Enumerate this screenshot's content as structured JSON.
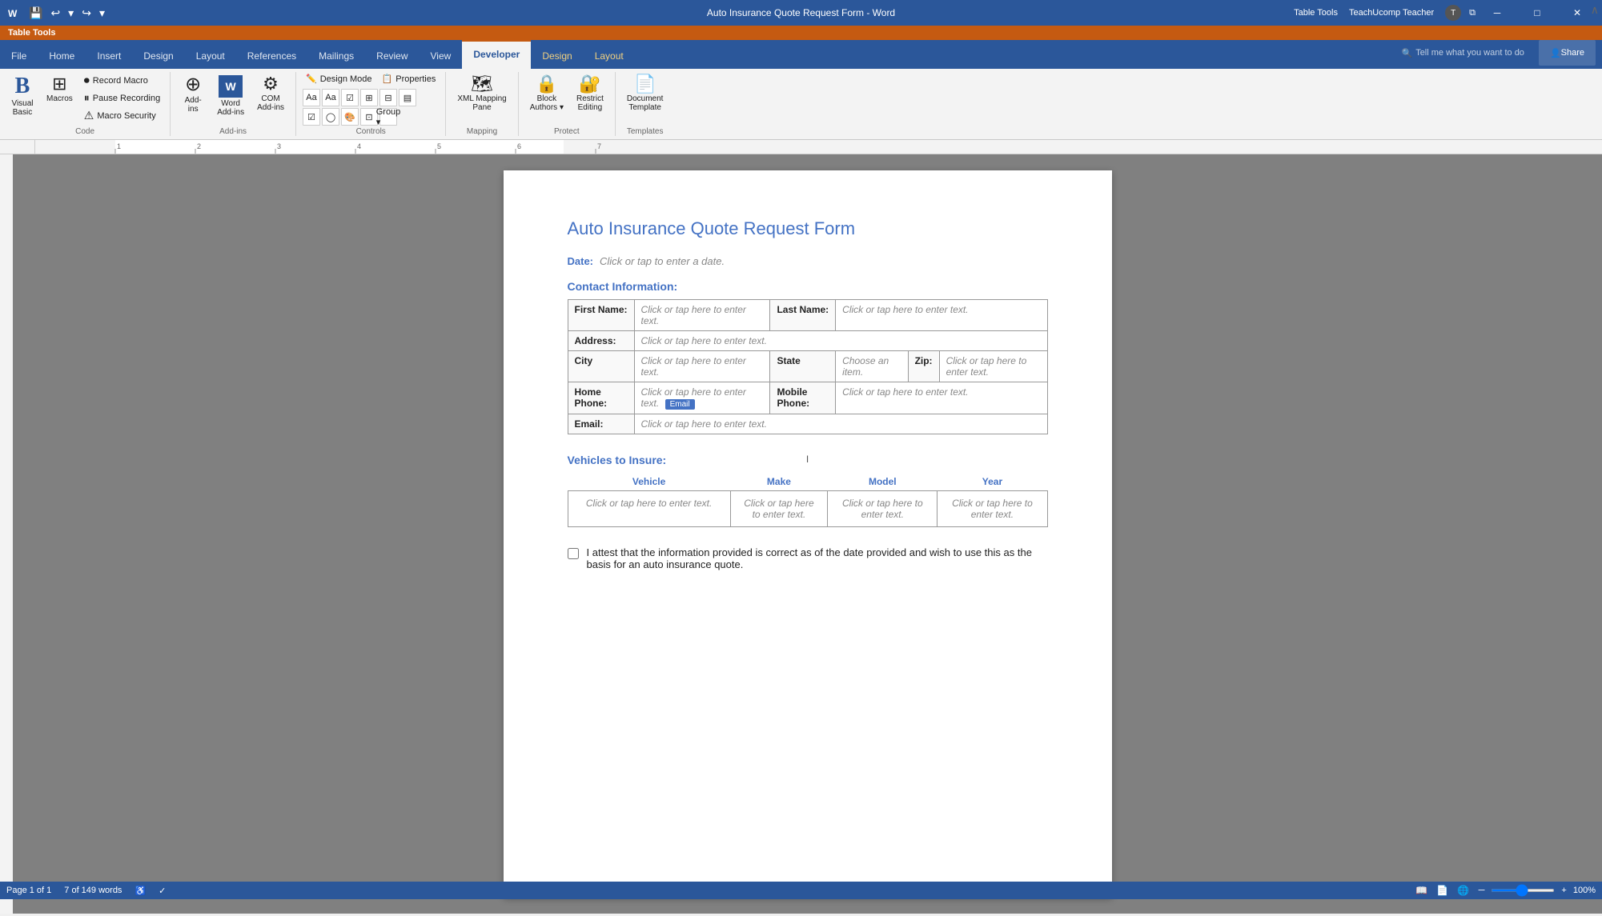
{
  "titleBar": {
    "title": "Auto Insurance Quote Request Form - Word",
    "tableTools": "Table Tools",
    "user": "TeachUcomp Teacher",
    "icons": {
      "save": "💾",
      "undo": "↩",
      "redo": "↪",
      "customize": "▾"
    }
  },
  "ribbon": {
    "tabs": [
      "File",
      "Home",
      "Insert",
      "Design",
      "Layout",
      "References",
      "Mailings",
      "Review",
      "View",
      "Developer",
      "Design",
      "Layout"
    ],
    "activeTab": "Developer",
    "tellMe": "Tell me what you want to do",
    "share": "Share",
    "groups": {
      "code": {
        "label": "Code",
        "buttons": {
          "visualBasic": {
            "label": "Visual\nBasic",
            "icon": "𝓑"
          },
          "macros": {
            "label": "Macros",
            "icon": "⬛"
          },
          "recordMacro": "Record Macro",
          "pauseRecording": "Pause Recording",
          "macroSecurity": "Macro Security"
        }
      },
      "addIns": {
        "label": "Add-ins",
        "buttons": {
          "addIns": {
            "label": "Add-\nins",
            "icon": "⊕"
          },
          "word": {
            "label": "Word\nAdd-ins",
            "icon": "W"
          },
          "com": {
            "label": "COM\nAdd-ins",
            "icon": "⚙"
          }
        }
      },
      "controls": {
        "label": "Controls",
        "designMode": "Design Mode",
        "properties": "Properties"
      },
      "mapping": {
        "label": "Mapping",
        "xmlMappingPane": "XML Mapping\nPane"
      },
      "protect": {
        "label": "Protect",
        "blockAuthors": "Block\nAuthors",
        "restrictEditing": "Restrict\nEditing"
      },
      "templates": {
        "label": "Templates",
        "documentTemplate": "Document\nTemplate"
      }
    }
  },
  "document": {
    "title": "Auto Insurance Quote Request Form",
    "dateLabel": "Date:",
    "datePlaceholder": "Click or tap to enter a date.",
    "contactSection": "Contact Information:",
    "table": {
      "rows": [
        {
          "cols": [
            {
              "label": "First Name:",
              "value": "Click or tap here to enter text."
            },
            {
              "label": "Last Name:",
              "value": "Click or tap here to enter text."
            }
          ]
        },
        {
          "cols": [
            {
              "label": "Address:",
              "value": "Click or tap here to enter text.",
              "colspan": 3
            }
          ]
        },
        {
          "cols": [
            {
              "label": "City",
              "value": "Click or tap here to enter text."
            },
            {
              "label": "State",
              "value": "Choose an item."
            },
            {
              "label": "Zip:",
              "value": "Click or tap here to enter text."
            }
          ]
        },
        {
          "cols": [
            {
              "label": "Home Phone:",
              "value": "Click or tap here to enter text.",
              "badge": "Email"
            },
            {
              "label": "Mobile Phone:",
              "value": "Click or tap here to enter text."
            }
          ]
        },
        {
          "cols": [
            {
              "label": "Email:",
              "value": "Click or tap here to enter text."
            }
          ]
        }
      ]
    },
    "vehiclesSection": "Vehicles to Insure:",
    "vehiclesTable": {
      "headers": [
        "Vehicle",
        "Make",
        "Model",
        "Year"
      ],
      "rows": [
        [
          "Click or tap here to enter text.",
          "Click or tap here to enter text.",
          "Click or tap here to enter text.",
          "Click or tap here to enter text."
        ]
      ]
    },
    "attestation": "I attest that the information provided is correct as of the date provided and wish to use this as the basis for an auto insurance quote."
  },
  "statusBar": {
    "page": "Page 1 of 1",
    "words": "7 of 149 words",
    "zoom": "100%"
  }
}
